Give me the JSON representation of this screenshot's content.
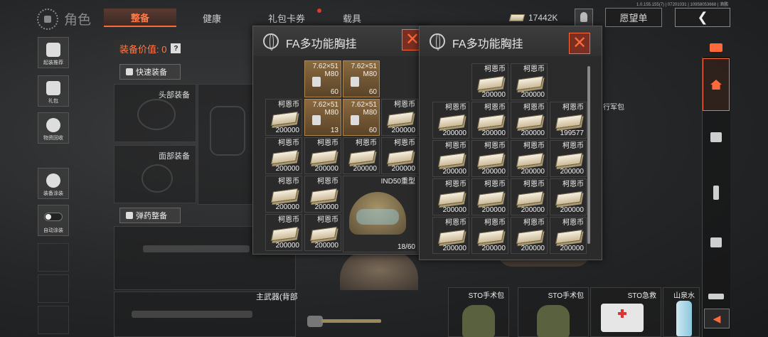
{
  "version": "1.0.155.155(7) | 07201031 | 10958053668 | 滴鹏",
  "header": {
    "title": "角色",
    "tabs": [
      "整备",
      "健康",
      "礼包卡券",
      "载具"
    ],
    "currency": "17442K",
    "wishlist": "愿望单"
  },
  "sidebar": {
    "items": [
      "起装推荐",
      "礼包",
      "物资回收",
      "装备涂装",
      "自动涂装"
    ]
  },
  "equipment": {
    "value_label": "装备价值: 0",
    "help": "?",
    "quick_equip": "快速装备",
    "head_label": "头部装备",
    "face_label": "面部装备",
    "ammo_btn": "弹药整备",
    "main_weapon": "主武器(背部"
  },
  "popup1": {
    "title": "FA多功能胸挂",
    "close": "✕",
    "cells": [
      {
        "name": "7.62×51\nM80",
        "count": "60",
        "kind": "ammo"
      },
      {
        "name": "7.62×51\nM80",
        "count": "60",
        "kind": "ammo"
      },
      {
        "name": "柯恩币",
        "count": "200000",
        "kind": "money"
      },
      {
        "name": "7.62×51\nM80",
        "count": "13",
        "kind": "ammo"
      },
      {
        "name": "7.62×51\nM80",
        "count": "60",
        "kind": "ammo"
      },
      {
        "name": "柯恩币",
        "count": "200000",
        "kind": "money"
      },
      {
        "name": "柯恩币",
        "count": "200000",
        "kind": "money"
      },
      {
        "name": "柯恩币",
        "count": "200000",
        "kind": "money"
      },
      {
        "name": "柯恩币",
        "count": "200000",
        "kind": "money"
      },
      {
        "name": "柯恩币",
        "count": "200000",
        "kind": "money"
      },
      {
        "name": "柯恩币",
        "count": "200000",
        "kind": "money"
      },
      {
        "name": "柯恩币",
        "count": "200000",
        "kind": "money"
      },
      {
        "name": "柯恩币",
        "count": "200000",
        "kind": "money"
      },
      {
        "name": "柯恩币",
        "count": "200000",
        "kind": "money"
      },
      {
        "name": "柯恩币",
        "count": "200000",
        "kind": "money"
      }
    ],
    "helmet": {
      "name": "IND50重型",
      "count": "18/60"
    }
  },
  "popup2": {
    "title": "FA多功能胸挂",
    "close": "✕",
    "cells": [
      {
        "name": "柯恩币",
        "count": "200000"
      },
      {
        "name": "柯恩币",
        "count": "200000"
      },
      {
        "name": "柯恩币",
        "count": "200000"
      },
      {
        "name": "柯恩币",
        "count": "200000"
      },
      {
        "name": "柯恩币",
        "count": "200000"
      },
      {
        "name": "柯恩币",
        "count": "199577"
      },
      {
        "name": "柯恩币",
        "count": "200000"
      },
      {
        "name": "柯恩币",
        "count": "200000"
      },
      {
        "name": "柯恩币",
        "count": "200000"
      },
      {
        "name": "柯恩币",
        "count": "200000"
      },
      {
        "name": "柯恩币",
        "count": "200000"
      },
      {
        "name": "柯恩币",
        "count": "200000"
      },
      {
        "name": "柯恩币",
        "count": "200000"
      },
      {
        "name": "柯恩币",
        "count": "200000"
      },
      {
        "name": "柯恩币",
        "count": "200000"
      },
      {
        "name": "柯恩币",
        "count": "200000"
      },
      {
        "name": "柯恩币",
        "count": "200000"
      },
      {
        "name": "柯恩币",
        "count": "200000"
      }
    ]
  },
  "behind": {
    "pack_label": "行军包"
  },
  "bottom_items": [
    {
      "name": "STO手术包"
    },
    {
      "name": "STO手术包"
    },
    {
      "name": "STO急救"
    },
    {
      "name": "山泉水"
    }
  ],
  "colors": {
    "accent": "#ff6a3a",
    "panel": "#2b2b2b",
    "money": "#efe6d0"
  }
}
